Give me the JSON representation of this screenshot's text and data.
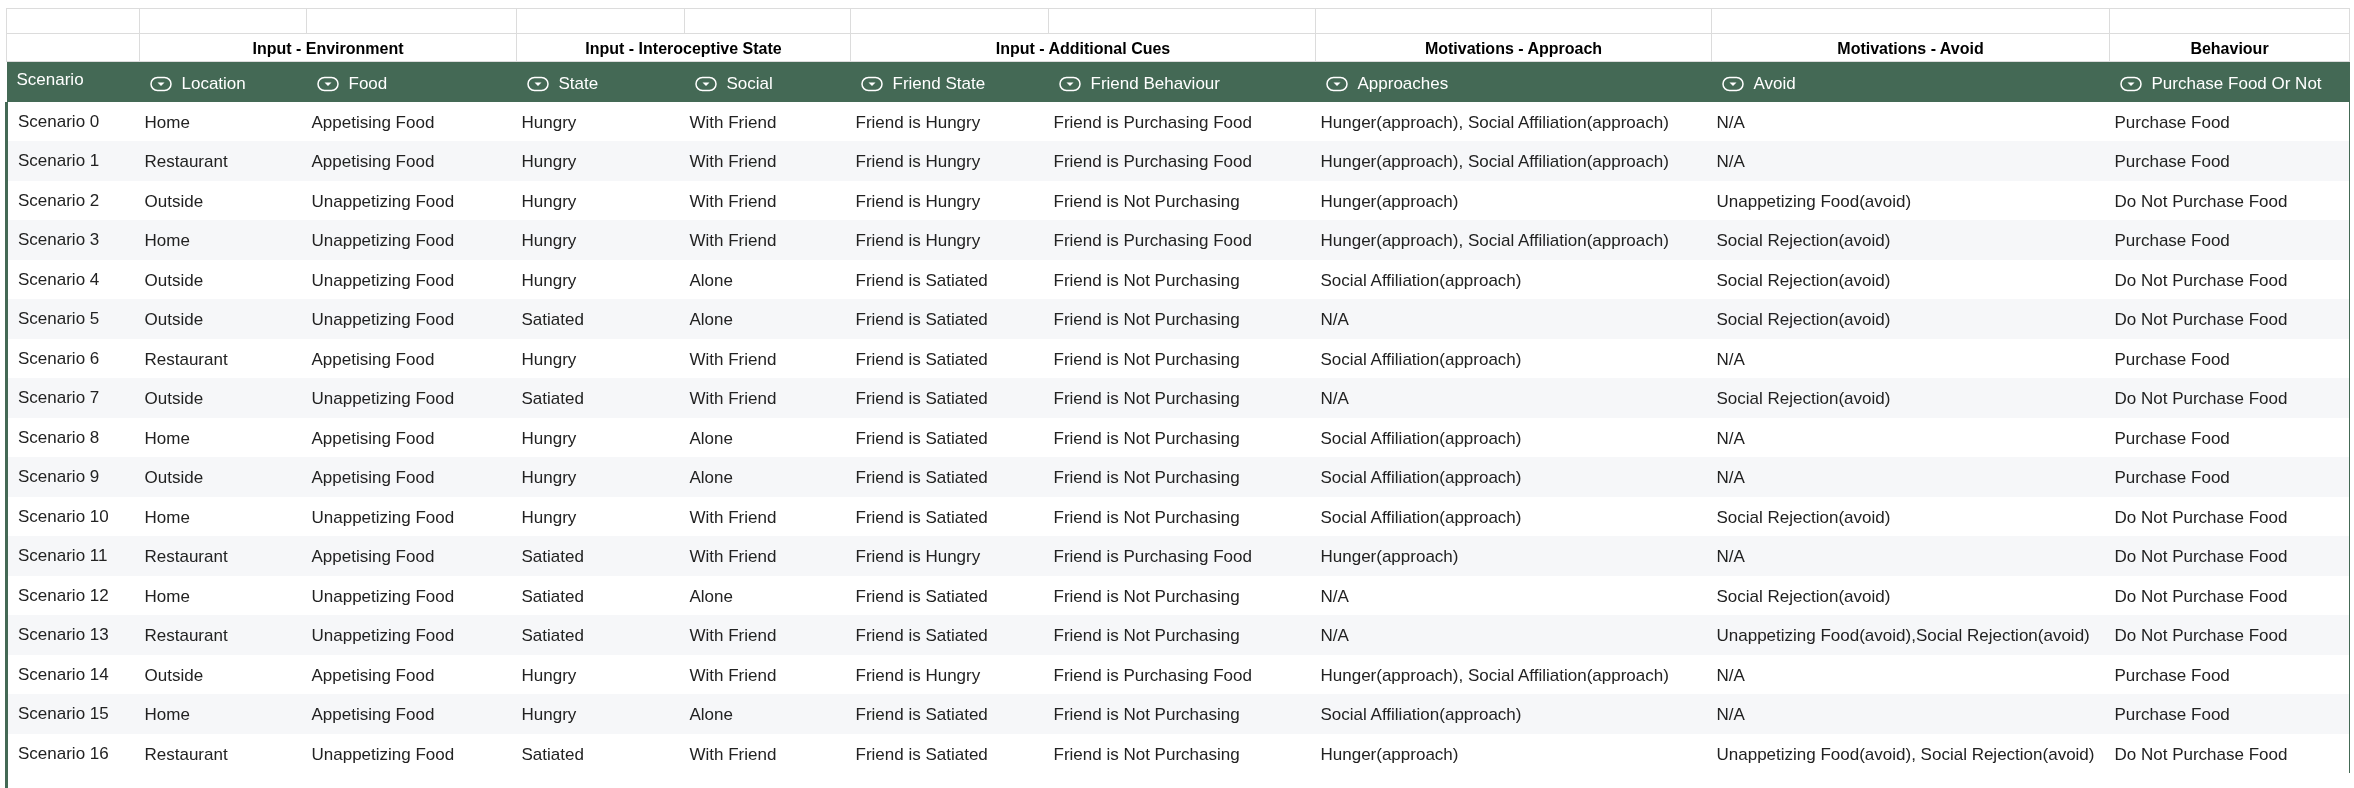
{
  "row_header": "Scenario",
  "groups": [
    {
      "label": "Input - Environment",
      "columns": [
        {
          "label": "Location",
          "filter": true
        },
        {
          "label": "Food",
          "filter": true
        }
      ]
    },
    {
      "label": "Input - Interoceptive State",
      "columns": [
        {
          "label": "State",
          "filter": true
        },
        {
          "label": "Social",
          "filter": true
        }
      ]
    },
    {
      "label": "Input - Additional Cues",
      "columns": [
        {
          "label": "Friend State",
          "filter": true
        },
        {
          "label": "Friend Behaviour",
          "filter": true
        }
      ]
    },
    {
      "label": "Motivations - Approach",
      "columns": [
        {
          "label": "Approaches",
          "filter": true
        }
      ]
    },
    {
      "label": "Motivations - Avoid",
      "columns": [
        {
          "label": "Avoid",
          "filter": true
        }
      ]
    },
    {
      "label": "Behaviour",
      "columns": [
        {
          "label": "Purchase Food Or Not",
          "filter": true
        }
      ]
    }
  ],
  "rows": [
    [
      "Scenario 0",
      "Home",
      "Appetising Food",
      "Hungry",
      "With Friend",
      "Friend is Hungry",
      "Friend is Purchasing Food",
      "Hunger(approach), Social Affiliation(approach)",
      "N/A",
      "Purchase Food"
    ],
    [
      "Scenario 1",
      "Restaurant",
      "Appetising Food",
      "Hungry",
      "With Friend",
      "Friend is Hungry",
      "Friend is Purchasing Food",
      "Hunger(approach), Social Affiliation(approach)",
      "N/A",
      "Purchase Food"
    ],
    [
      "Scenario 2",
      "Outside",
      "Unappetizing Food",
      "Hungry",
      "With Friend",
      "Friend is Hungry",
      "Friend is Not Purchasing",
      "Hunger(approach)",
      "Unappetizing Food(avoid)",
      "Do Not Purchase Food"
    ],
    [
      "Scenario 3",
      "Home",
      "Unappetizing Food",
      "Hungry",
      "With Friend",
      "Friend is Hungry",
      "Friend is Purchasing Food",
      "Hunger(approach), Social Affiliation(approach)",
      "Social Rejection(avoid)",
      "Purchase Food"
    ],
    [
      "Scenario 4",
      "Outside",
      "Unappetizing Food",
      "Hungry",
      "Alone",
      "Friend is Satiated",
      "Friend is Not Purchasing",
      "Social Affiliation(approach)",
      "Social Rejection(avoid)",
      "Do Not Purchase Food"
    ],
    [
      "Scenario 5",
      "Outside",
      "Unappetizing Food",
      "Satiated",
      "Alone",
      "Friend is Satiated",
      "Friend is Not Purchasing",
      "N/A",
      "Social Rejection(avoid)",
      "Do Not Purchase Food"
    ],
    [
      "Scenario 6",
      "Restaurant",
      "Appetising Food",
      "Hungry",
      "With Friend",
      "Friend is Satiated",
      "Friend is Not Purchasing",
      "Social Affiliation(approach)",
      "N/A",
      "Purchase Food"
    ],
    [
      "Scenario 7",
      "Outside",
      "Unappetizing Food",
      "Satiated",
      "With Friend",
      "Friend is Satiated",
      "Friend is Not Purchasing",
      "N/A",
      "Social Rejection(avoid)",
      "Do Not Purchase Food"
    ],
    [
      "Scenario 8",
      "Home",
      "Appetising Food",
      "Hungry",
      "Alone",
      "Friend is Satiated",
      "Friend is Not Purchasing",
      "Social Affiliation(approach)",
      "N/A",
      "Purchase Food"
    ],
    [
      "Scenario 9",
      "Outside",
      "Appetising Food",
      "Hungry",
      "Alone",
      "Friend is Satiated",
      "Friend is Not Purchasing",
      "Social Affiliation(approach)",
      "N/A",
      "Purchase Food"
    ],
    [
      "Scenario 10",
      "Home",
      "Unappetizing Food",
      "Hungry",
      "With Friend",
      "Friend is Satiated",
      "Friend is Not Purchasing",
      "Social Affiliation(approach)",
      "Social Rejection(avoid)",
      "Do Not Purchase Food"
    ],
    [
      "Scenario 11",
      "Restaurant",
      "Appetising Food",
      "Satiated",
      "With Friend",
      "Friend is Hungry",
      "Friend is Purchasing Food",
      "Hunger(approach)",
      "N/A",
      "Do Not Purchase Food"
    ],
    [
      "Scenario 12",
      "Home",
      "Unappetizing Food",
      "Satiated",
      "Alone",
      "Friend is Satiated",
      "Friend is Not Purchasing",
      "N/A",
      "Social Rejection(avoid)",
      "Do Not Purchase Food"
    ],
    [
      "Scenario 13",
      "Restaurant",
      "Unappetizing Food",
      "Satiated",
      "With Friend",
      "Friend is Satiated",
      "Friend is Not Purchasing",
      "N/A",
      "Unappetizing Food(avoid),Social Rejection(avoid)",
      "Do Not Purchase Food"
    ],
    [
      "Scenario 14",
      "Outside",
      "Appetising Food",
      "Hungry",
      "With Friend",
      "Friend is Hungry",
      "Friend is Purchasing Food",
      "Hunger(approach), Social Affiliation(approach)",
      "N/A",
      "Purchase Food"
    ],
    [
      "Scenario 15",
      "Home",
      "Appetising Food",
      "Hungry",
      "Alone",
      "Friend is Satiated",
      "Friend is Not Purchasing",
      "Social Affiliation(approach)",
      "N/A",
      "Purchase Food"
    ],
    [
      "Scenario 16",
      "Restaurant",
      "Unappetizing Food",
      "Satiated",
      "With Friend",
      "Friend is Satiated",
      "Friend is Not Purchasing",
      "Hunger(approach)",
      "Unappetizing Food(avoid), Social Rejection(avoid)",
      "Do Not Purchase Food"
    ]
  ]
}
